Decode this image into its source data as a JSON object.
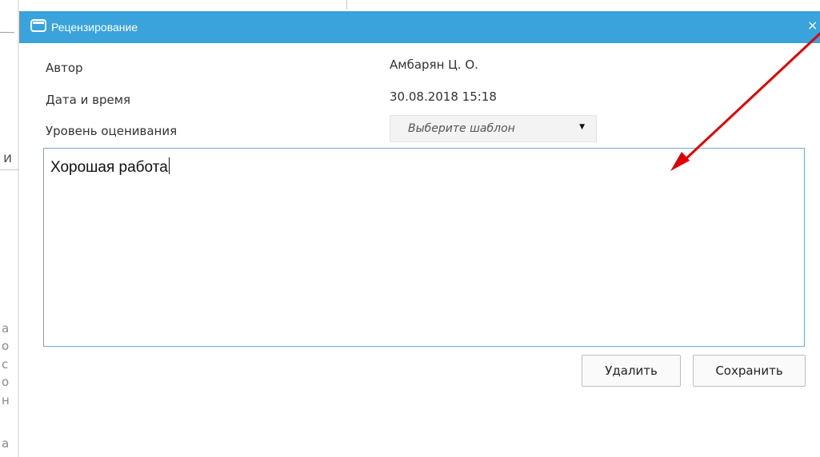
{
  "dialog": {
    "title": "Рецензирование",
    "close_glyph": "×",
    "icon": "window-icon"
  },
  "fields": {
    "author_label": "Автор",
    "author_value": "Амбарян Ц. О.",
    "datetime_label": "Дата и время",
    "datetime_value": "30.08.2018 15:18",
    "level_label": "Уровень оценивания",
    "level_placeholder": "Выберите шаблон"
  },
  "review_text": "Хорошая работа",
  "buttons": {
    "delete_label": "Удалить",
    "save_label": "Сохранить"
  },
  "background_fragments": [
    "и",
    "а",
    "о",
    "с",
    "о",
    "н",
    "а"
  ],
  "colors": {
    "titlebar": "#3aa3db",
    "textarea_border": "#73a7d8",
    "annotation_arrow": "#e10000"
  }
}
